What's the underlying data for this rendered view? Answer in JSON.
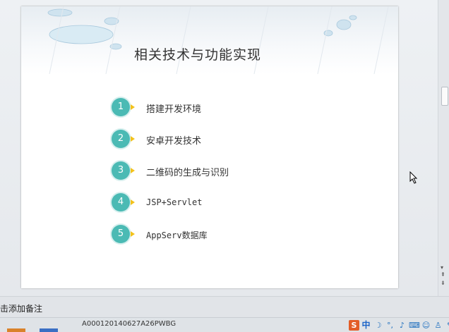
{
  "slide": {
    "title": "相关技术与功能实现",
    "items": [
      {
        "num": "1",
        "label": "搭建开发环境"
      },
      {
        "num": "2",
        "label": "安卓开发技术"
      },
      {
        "num": "3",
        "label": "二维码的生成与识别"
      },
      {
        "num": "4",
        "label": "JSP+Servlet"
      },
      {
        "num": "5",
        "label": "AppServ数据库"
      }
    ],
    "accent_color": "#4bbab4",
    "arrow_color": "#f3c21c"
  },
  "notes": {
    "placeholder": "单击此处添加备注",
    "visible_text": "击添加备注"
  },
  "status": {
    "code": "A000120140627A26PWBG"
  },
  "ime": {
    "logo": "S",
    "mode": "中",
    "icons": [
      "moon-icon",
      "punctuation-icon",
      "mic-icon",
      "keyboard-icon",
      "user-icon",
      "shirt-icon",
      "wrench-icon"
    ]
  }
}
